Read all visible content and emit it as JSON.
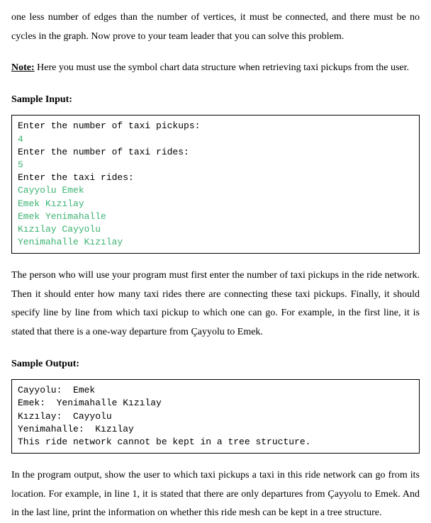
{
  "intro_paragraph": "one less number of edges than the number of vertices, it must be connected, and there must be no cycles in the graph. Now prove to your team leader that you can solve this problem.",
  "note": {
    "label": "Note:",
    "text": " Here you must use the symbol chart data structure when retrieving taxi pickups from the user."
  },
  "sample_input": {
    "heading": "Sample Input:",
    "lines": [
      {
        "text": "Enter the number of taxi pickups:",
        "user": false
      },
      {
        "text": "4",
        "user": true
      },
      {
        "text": "Enter the number of taxi rides:",
        "user": false
      },
      {
        "text": "5",
        "user": true
      },
      {
        "text": "Enter the taxi rides:",
        "user": false
      },
      {
        "text": "Cayyolu Emek",
        "user": true
      },
      {
        "text": "Emek Kızılay",
        "user": true
      },
      {
        "text": "Emek Yenimahalle",
        "user": true
      },
      {
        "text": "Kızılay Cayyolu",
        "user": true
      },
      {
        "text": "Yenimahalle Kızılay",
        "user": true
      }
    ]
  },
  "middle_paragraph": "The person who will use your program must first enter the number of taxi pickups in the ride network. Then it should enter how many taxi rides there are connecting these taxi pickups. Finally, it should specify line by line from which taxi pickup to which one can go. For example, in the first line, it is stated that there is a one-way departure from Çayyolu to Emek.",
  "sample_output": {
    "heading": "Sample Output:",
    "lines": [
      {
        "text": "Cayyolu:  Emek",
        "user": false
      },
      {
        "text": "Emek:  Yenimahalle Kızılay",
        "user": false
      },
      {
        "text": "Kızılay:  Cayyolu",
        "user": false
      },
      {
        "text": "Yenimahalle:  Kızılay",
        "user": false
      },
      {
        "text": "This ride network cannot be kept in a tree structure.",
        "user": false
      }
    ]
  },
  "final_paragraph": "In the program output, show the user to which taxi pickups a taxi in this ride network can go from its location. For example, in line 1, it is stated that there are only departures from Çayyolu to Emek. And in the last line, print the information on whether this ride mesh can be kept in a tree structure."
}
